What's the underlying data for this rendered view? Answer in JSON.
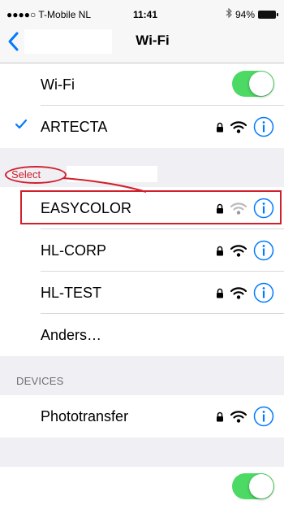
{
  "status_bar": {
    "carrier": "●●●●○ T-Mobile NL",
    "time": "11:41",
    "battery": "94%"
  },
  "nav": {
    "title": "Wi-Fi",
    "back_icon": "chevron-left-icon"
  },
  "wifi_toggle": {
    "label": "Wi-Fi",
    "on": true
  },
  "connected_network": {
    "name": "ARTECTA",
    "checked": true,
    "secured": true,
    "signal": "full"
  },
  "annotation": {
    "label": "Select",
    "color": "#d0202b"
  },
  "networks": [
    {
      "name": "EASYCOLOR",
      "secured": true,
      "signal": "weak"
    },
    {
      "name": "HL-CORP",
      "secured": true,
      "signal": "full"
    },
    {
      "name": "HL-TEST",
      "secured": true,
      "signal": "full"
    },
    {
      "name": "Anders…",
      "secured": false,
      "signal": ""
    }
  ],
  "devices": {
    "header": "DEVICES",
    "items": [
      {
        "name": "Phototransfer",
        "secured": true,
        "signal": "full"
      }
    ]
  },
  "bottom_toggle": {
    "on": true
  },
  "colors": {
    "accent": "#007aff",
    "toggle_on": "#4cd964",
    "annotation": "#d0202b",
    "background": "#efeff4"
  }
}
